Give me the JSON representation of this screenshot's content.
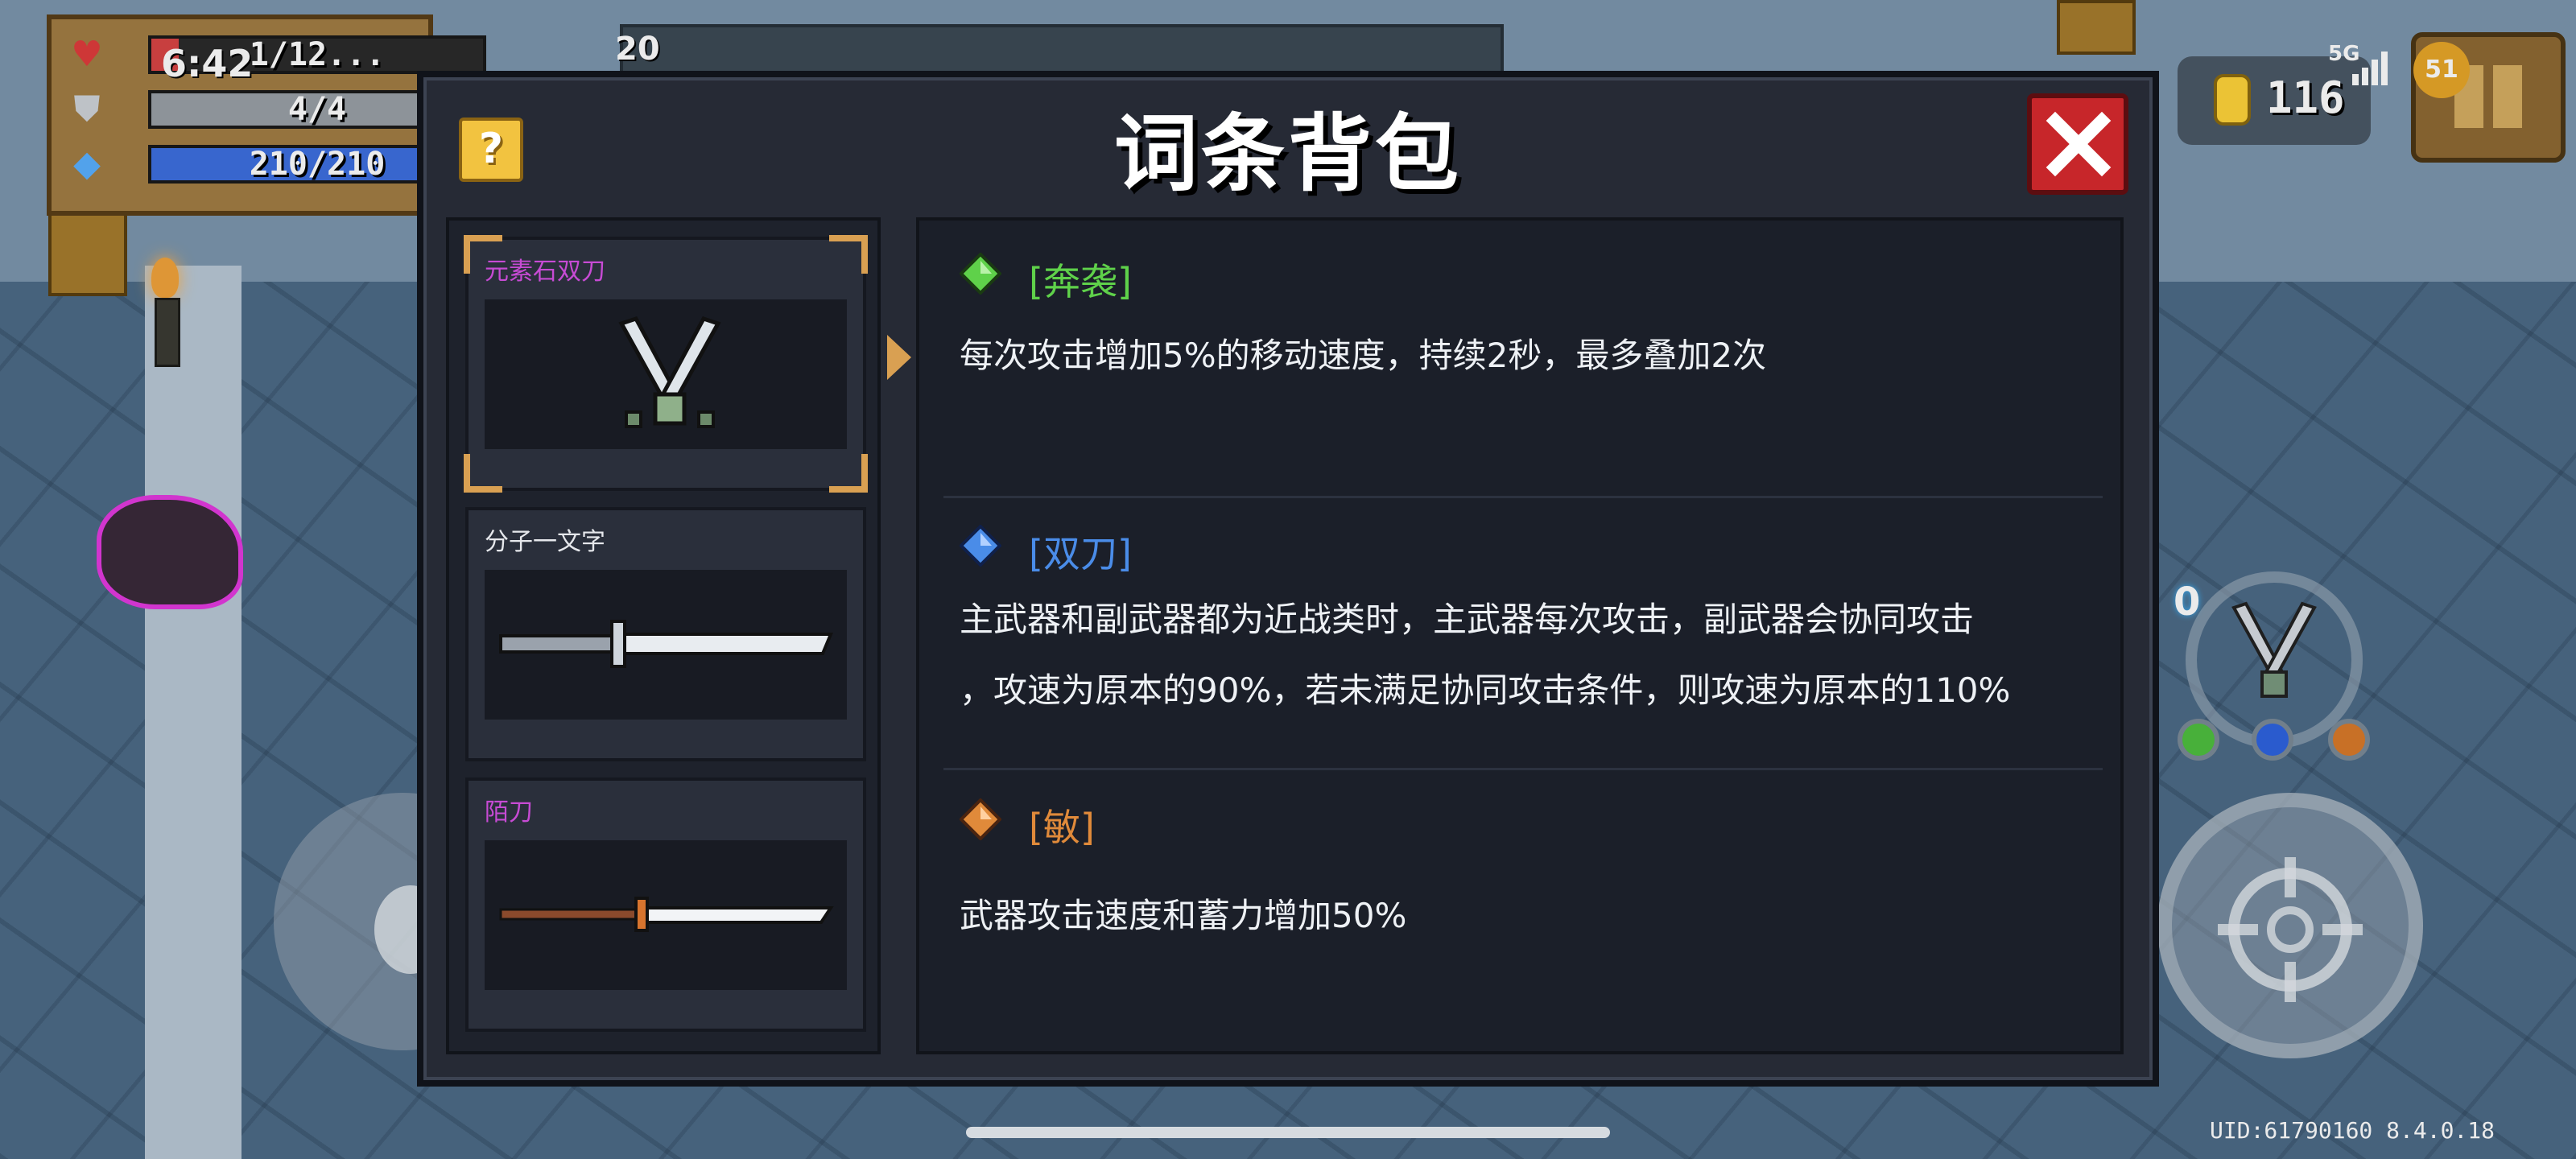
{
  "hud": {
    "clock": "6:42",
    "hp": {
      "text": "1/12...",
      "fraction": 0.083,
      "color": "#d94545"
    },
    "armor": {
      "text": "4/4",
      "fraction": 1.0,
      "color": "#9aa0a6"
    },
    "energy": {
      "text": "210/210",
      "fraction": 1.0,
      "color": "#3d6fe0"
    },
    "hp_icon": "heart-icon",
    "armor_icon": "shield-icon",
    "energy_icon": "diamond-icon",
    "top_count": "20",
    "coins": "116",
    "network": "5G",
    "battery": "51",
    "weapon_slot_number": "0",
    "uid": "UID:61790160 8.4.0.18"
  },
  "dialog": {
    "title": "词条背包",
    "help_label": "?",
    "weapons": [
      {
        "name": "元素石双刀",
        "name_color": "#c74bd4",
        "selected": true
      },
      {
        "name": "分子一文字",
        "name_color": "#e6e8ec",
        "selected": false
      },
      {
        "name": "陌刀",
        "name_color": "#c74bd4",
        "selected": false
      }
    ],
    "affixes": [
      {
        "name": "[奔袭]",
        "color": "#5fd14a",
        "gem": "green-gem-icon",
        "desc": "每次攻击增加5%的移动速度，持续2秒，最多叠加2次"
      },
      {
        "name": "[双刀]",
        "color": "#4a8ce8",
        "gem": "blue-gem-icon",
        "desc_line1": "主武器和副武器都为近战类时，主武器每次攻击，副武器会协同攻击",
        "desc_line2": "，攻速为原本的90%，若未满足协同攻击条件，则攻速为原本的110%"
      },
      {
        "name": "[敏]",
        "color": "#e08a3a",
        "gem": "orange-gem-icon",
        "desc": "武器攻击速度和蓄力增加50%"
      }
    ]
  }
}
